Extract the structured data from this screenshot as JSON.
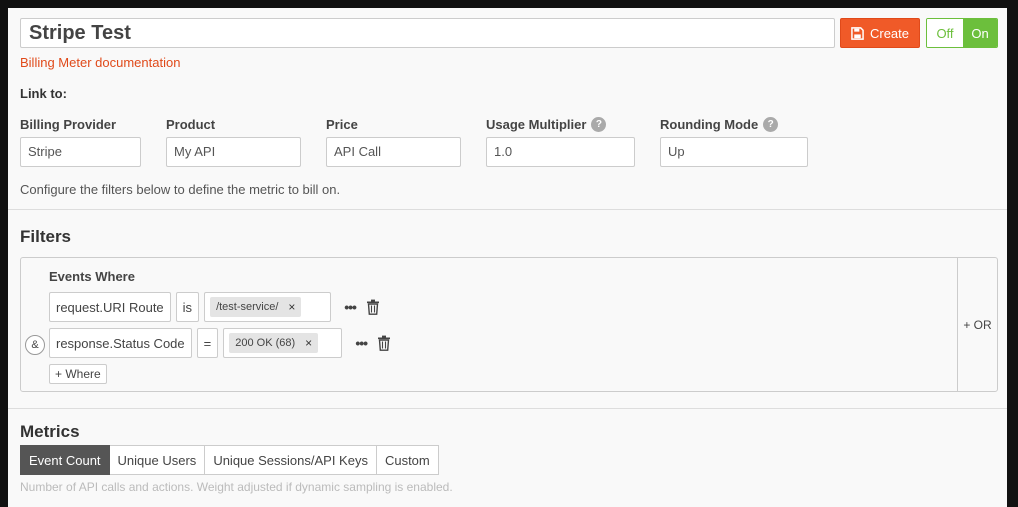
{
  "header": {
    "title_value": "Stripe Test",
    "create_label": "Create",
    "toggle_off": "Off",
    "toggle_on": "On",
    "doc_link": "Billing Meter documentation",
    "link_to": "Link to:"
  },
  "fields": {
    "billing_provider": {
      "label": "Billing Provider",
      "value": "Stripe"
    },
    "product": {
      "label": "Product",
      "value": "My API"
    },
    "price": {
      "label": "Price",
      "value": "API Call"
    },
    "usage_multiplier": {
      "label": "Usage Multiplier",
      "value": "1.0"
    },
    "rounding_mode": {
      "label": "Rounding Mode",
      "value": "Up"
    },
    "help_glyph": "?"
  },
  "configure_text": "Configure the filters below to define the metric to bill on.",
  "filters": {
    "title": "Filters",
    "events_where": "Events Where",
    "rows": [
      {
        "field": "request.URI Route",
        "operator": "is",
        "value": "/test-service/"
      },
      {
        "field": "response.Status Code",
        "operator": "=",
        "value": "200 OK (68)"
      }
    ],
    "and_label": "&",
    "add_where": "+ Where",
    "or_label": "+ OR",
    "remove_glyph": "×",
    "more_glyph": "•••"
  },
  "metrics": {
    "title": "Metrics",
    "tabs": [
      "Event Count",
      "Unique Users",
      "Unique Sessions/API Keys",
      "Custom"
    ],
    "active_tab": "Event Count",
    "description": "Number of API calls and actions. Weight adjusted if dynamic sampling is enabled."
  },
  "colors": {
    "accent": "#f05a28",
    "toggle_green": "#6cbf3c",
    "active_tab": "#555555"
  }
}
